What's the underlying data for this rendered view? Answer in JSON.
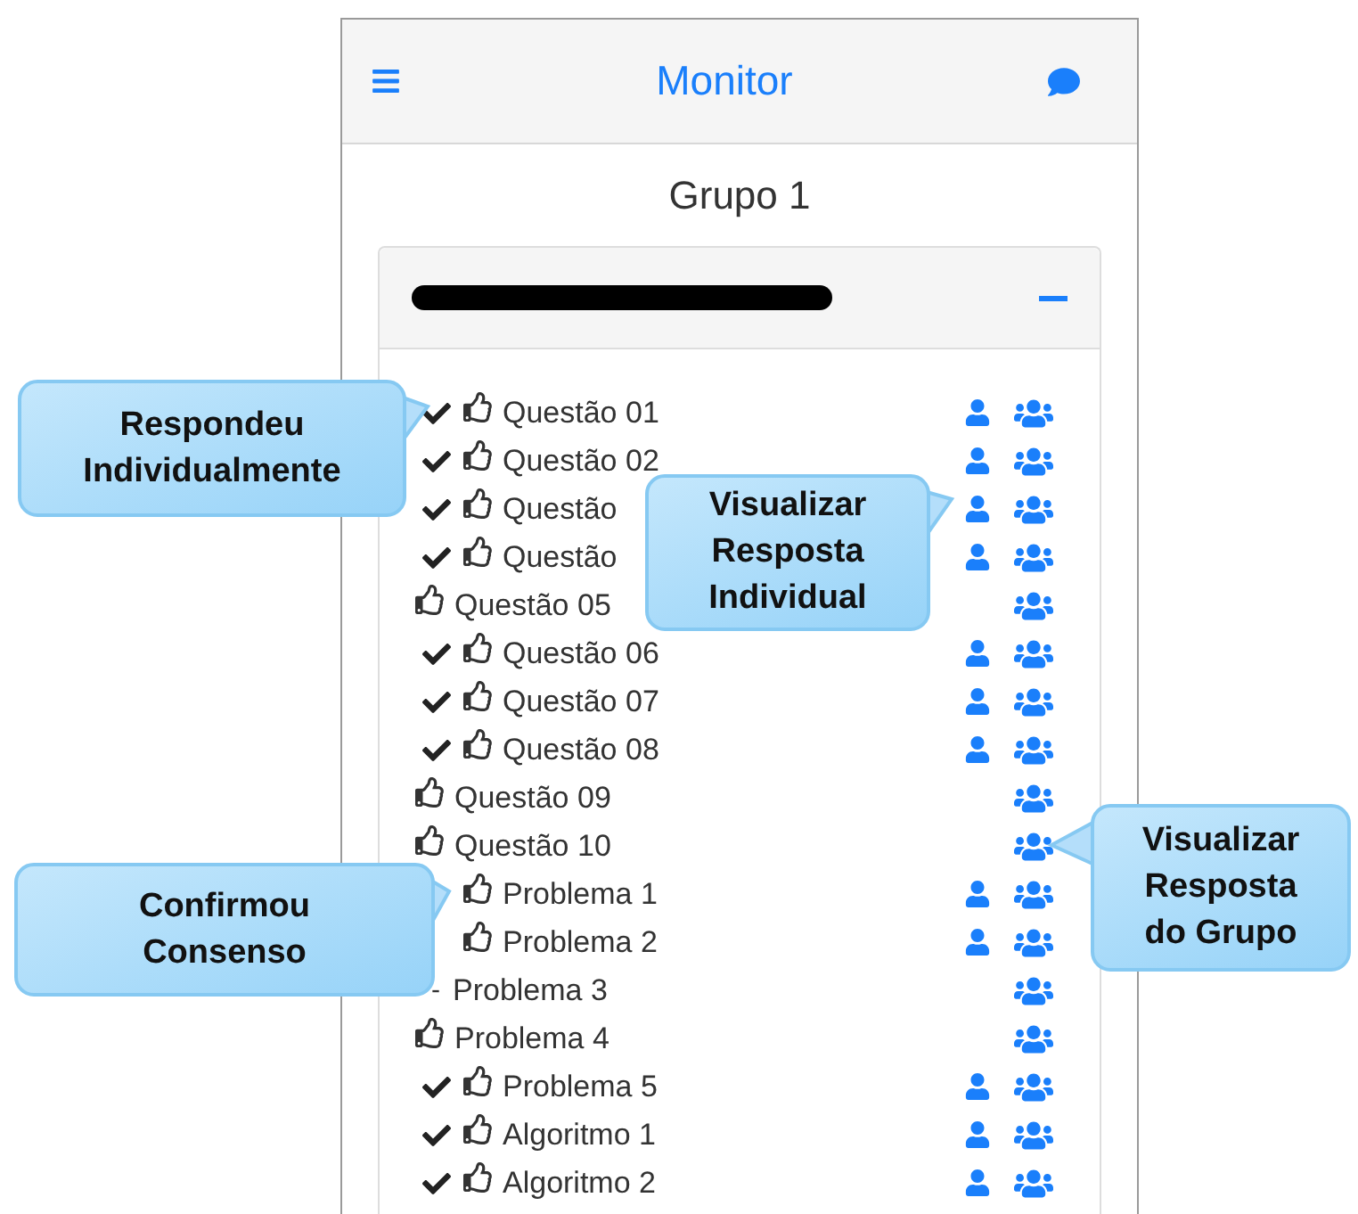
{
  "header": {
    "title": "Monitor"
  },
  "group_title": "Grupo 1",
  "panel": {
    "expanded": true
  },
  "items": [
    {
      "label": "Questão 01",
      "answered": true,
      "indented": false,
      "consensus": true,
      "individual_view": true
    },
    {
      "label": "Questão 02",
      "answered": true,
      "indented": false,
      "consensus": true,
      "individual_view": true
    },
    {
      "label": "Questão",
      "answered": true,
      "indented": false,
      "consensus": true,
      "individual_view": true
    },
    {
      "label": "Questão",
      "answered": true,
      "indented": false,
      "consensus": true,
      "individual_view": true
    },
    {
      "label": "Questão 05",
      "answered": false,
      "indented": false,
      "consensus": true,
      "individual_view": false
    },
    {
      "label": "Questão 06",
      "answered": true,
      "indented": false,
      "consensus": true,
      "individual_view": true
    },
    {
      "label": "Questão 07",
      "answered": true,
      "indented": false,
      "consensus": true,
      "individual_view": true
    },
    {
      "label": "Questão 08",
      "answered": true,
      "indented": false,
      "consensus": true,
      "individual_view": true
    },
    {
      "label": "Questão 09",
      "answered": false,
      "indented": false,
      "consensus": true,
      "individual_view": false
    },
    {
      "label": "Questão 10",
      "answered": false,
      "indented": false,
      "consensus": true,
      "individual_view": false
    },
    {
      "label": "Problema 1",
      "answered": false,
      "indented": true,
      "consensus": true,
      "individual_view": true
    },
    {
      "label": "Problema 2",
      "answered": false,
      "indented": true,
      "consensus": true,
      "individual_view": true
    },
    {
      "label": "Problema 3",
      "answered": false,
      "indented": false,
      "consensus": false,
      "marker": "-",
      "individual_view": false
    },
    {
      "label": "Problema 4",
      "answered": false,
      "indented": false,
      "consensus": true,
      "individual_view": false
    },
    {
      "label": "Problema 5",
      "answered": true,
      "indented": false,
      "consensus": true,
      "individual_view": true
    },
    {
      "label": "Algoritmo 1",
      "answered": true,
      "indented": false,
      "consensus": true,
      "individual_view": true
    },
    {
      "label": "Algoritmo 2",
      "answered": true,
      "indented": false,
      "consensus": true,
      "individual_view": true
    }
  ],
  "callouts": [
    {
      "text": "Respondeu\nIndividualmente"
    },
    {
      "text": "Visualizar\nResposta\nIndividual"
    },
    {
      "text": "Confirmou\nConsenso"
    },
    {
      "text": "Visualizar\nResposta\ndo Grupo"
    }
  ]
}
